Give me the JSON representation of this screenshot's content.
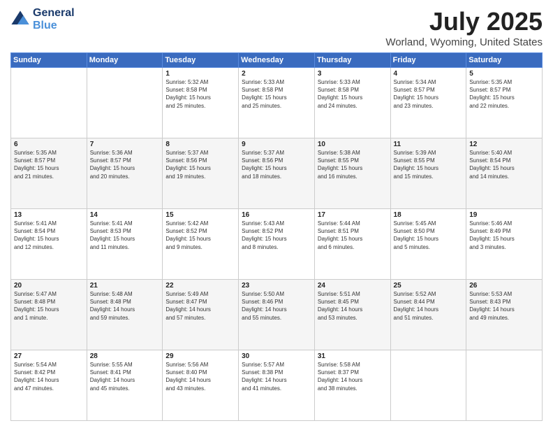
{
  "header": {
    "logo_line1": "General",
    "logo_line2": "Blue",
    "month": "July 2025",
    "location": "Worland, Wyoming, United States"
  },
  "weekdays": [
    "Sunday",
    "Monday",
    "Tuesday",
    "Wednesday",
    "Thursday",
    "Friday",
    "Saturday"
  ],
  "weeks": [
    [
      {
        "day": "",
        "info": ""
      },
      {
        "day": "",
        "info": ""
      },
      {
        "day": "1",
        "info": "Sunrise: 5:32 AM\nSunset: 8:58 PM\nDaylight: 15 hours\nand 25 minutes."
      },
      {
        "day": "2",
        "info": "Sunrise: 5:33 AM\nSunset: 8:58 PM\nDaylight: 15 hours\nand 25 minutes."
      },
      {
        "day": "3",
        "info": "Sunrise: 5:33 AM\nSunset: 8:58 PM\nDaylight: 15 hours\nand 24 minutes."
      },
      {
        "day": "4",
        "info": "Sunrise: 5:34 AM\nSunset: 8:57 PM\nDaylight: 15 hours\nand 23 minutes."
      },
      {
        "day": "5",
        "info": "Sunrise: 5:35 AM\nSunset: 8:57 PM\nDaylight: 15 hours\nand 22 minutes."
      }
    ],
    [
      {
        "day": "6",
        "info": "Sunrise: 5:35 AM\nSunset: 8:57 PM\nDaylight: 15 hours\nand 21 minutes."
      },
      {
        "day": "7",
        "info": "Sunrise: 5:36 AM\nSunset: 8:57 PM\nDaylight: 15 hours\nand 20 minutes."
      },
      {
        "day": "8",
        "info": "Sunrise: 5:37 AM\nSunset: 8:56 PM\nDaylight: 15 hours\nand 19 minutes."
      },
      {
        "day": "9",
        "info": "Sunrise: 5:37 AM\nSunset: 8:56 PM\nDaylight: 15 hours\nand 18 minutes."
      },
      {
        "day": "10",
        "info": "Sunrise: 5:38 AM\nSunset: 8:55 PM\nDaylight: 15 hours\nand 16 minutes."
      },
      {
        "day": "11",
        "info": "Sunrise: 5:39 AM\nSunset: 8:55 PM\nDaylight: 15 hours\nand 15 minutes."
      },
      {
        "day": "12",
        "info": "Sunrise: 5:40 AM\nSunset: 8:54 PM\nDaylight: 15 hours\nand 14 minutes."
      }
    ],
    [
      {
        "day": "13",
        "info": "Sunrise: 5:41 AM\nSunset: 8:54 PM\nDaylight: 15 hours\nand 12 minutes."
      },
      {
        "day": "14",
        "info": "Sunrise: 5:41 AM\nSunset: 8:53 PM\nDaylight: 15 hours\nand 11 minutes."
      },
      {
        "day": "15",
        "info": "Sunrise: 5:42 AM\nSunset: 8:52 PM\nDaylight: 15 hours\nand 9 minutes."
      },
      {
        "day": "16",
        "info": "Sunrise: 5:43 AM\nSunset: 8:52 PM\nDaylight: 15 hours\nand 8 minutes."
      },
      {
        "day": "17",
        "info": "Sunrise: 5:44 AM\nSunset: 8:51 PM\nDaylight: 15 hours\nand 6 minutes."
      },
      {
        "day": "18",
        "info": "Sunrise: 5:45 AM\nSunset: 8:50 PM\nDaylight: 15 hours\nand 5 minutes."
      },
      {
        "day": "19",
        "info": "Sunrise: 5:46 AM\nSunset: 8:49 PM\nDaylight: 15 hours\nand 3 minutes."
      }
    ],
    [
      {
        "day": "20",
        "info": "Sunrise: 5:47 AM\nSunset: 8:48 PM\nDaylight: 15 hours\nand 1 minute."
      },
      {
        "day": "21",
        "info": "Sunrise: 5:48 AM\nSunset: 8:48 PM\nDaylight: 14 hours\nand 59 minutes."
      },
      {
        "day": "22",
        "info": "Sunrise: 5:49 AM\nSunset: 8:47 PM\nDaylight: 14 hours\nand 57 minutes."
      },
      {
        "day": "23",
        "info": "Sunrise: 5:50 AM\nSunset: 8:46 PM\nDaylight: 14 hours\nand 55 minutes."
      },
      {
        "day": "24",
        "info": "Sunrise: 5:51 AM\nSunset: 8:45 PM\nDaylight: 14 hours\nand 53 minutes."
      },
      {
        "day": "25",
        "info": "Sunrise: 5:52 AM\nSunset: 8:44 PM\nDaylight: 14 hours\nand 51 minutes."
      },
      {
        "day": "26",
        "info": "Sunrise: 5:53 AM\nSunset: 8:43 PM\nDaylight: 14 hours\nand 49 minutes."
      }
    ],
    [
      {
        "day": "27",
        "info": "Sunrise: 5:54 AM\nSunset: 8:42 PM\nDaylight: 14 hours\nand 47 minutes."
      },
      {
        "day": "28",
        "info": "Sunrise: 5:55 AM\nSunset: 8:41 PM\nDaylight: 14 hours\nand 45 minutes."
      },
      {
        "day": "29",
        "info": "Sunrise: 5:56 AM\nSunset: 8:40 PM\nDaylight: 14 hours\nand 43 minutes."
      },
      {
        "day": "30",
        "info": "Sunrise: 5:57 AM\nSunset: 8:38 PM\nDaylight: 14 hours\nand 41 minutes."
      },
      {
        "day": "31",
        "info": "Sunrise: 5:58 AM\nSunset: 8:37 PM\nDaylight: 14 hours\nand 38 minutes."
      },
      {
        "day": "",
        "info": ""
      },
      {
        "day": "",
        "info": ""
      }
    ]
  ]
}
